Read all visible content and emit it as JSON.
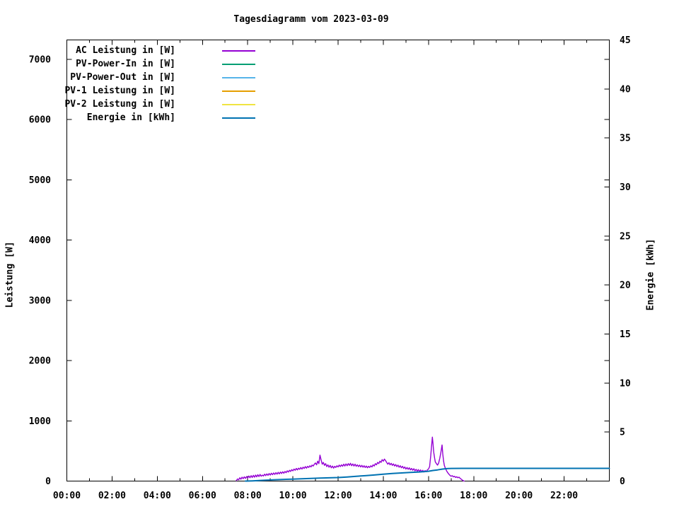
{
  "chart_data": {
    "type": "line",
    "title": "Tagesdiagramm vom 2023-03-09",
    "grid": false,
    "legend_position": "top-left-inside",
    "x_axis": {
      "unit": "time-of-day",
      "range_hours": [
        0,
        24
      ],
      "major_tick_every_hours": 2,
      "minor_tick_every_hours": 1,
      "tick_labels": [
        "00:00",
        "02:00",
        "04:00",
        "06:00",
        "08:00",
        "10:00",
        "12:00",
        "14:00",
        "16:00",
        "18:00",
        "20:00",
        "22:00"
      ]
    },
    "y_left_axis": {
      "label": "Leistung [W]",
      "ticks": [
        0,
        1000,
        2000,
        3000,
        4000,
        5000,
        6000,
        7000
      ],
      "range": [
        0,
        7320
      ]
    },
    "y_right_axis": {
      "label": "Energie [kWh]",
      "ticks": [
        0,
        5,
        10,
        15,
        20,
        25,
        30,
        35,
        40,
        45
      ],
      "range": [
        0,
        45
      ]
    },
    "series": [
      {
        "name": "AC Leistung in [W]",
        "color": "#9400D3",
        "axis": "left",
        "points": [
          [
            7.5,
            8
          ],
          [
            7.55,
            35
          ],
          [
            7.6,
            20
          ],
          [
            7.65,
            55
          ],
          [
            7.7,
            30
          ],
          [
            7.75,
            65
          ],
          [
            7.8,
            40
          ],
          [
            7.85,
            70
          ],
          [
            7.9,
            45
          ],
          [
            7.95,
            75
          ],
          [
            8.0,
            50
          ],
          [
            8.05,
            85
          ],
          [
            8.1,
            55
          ],
          [
            8.15,
            90
          ],
          [
            8.2,
            60
          ],
          [
            8.25,
            95
          ],
          [
            8.3,
            65
          ],
          [
            8.35,
            100
          ],
          [
            8.4,
            70
          ],
          [
            8.45,
            105
          ],
          [
            8.5,
            75
          ],
          [
            8.55,
            110
          ],
          [
            8.6,
            80
          ],
          [
            8.65,
            100
          ],
          [
            8.7,
            85
          ],
          [
            8.75,
            115
          ],
          [
            8.8,
            90
          ],
          [
            8.85,
            120
          ],
          [
            8.9,
            95
          ],
          [
            8.95,
            125
          ],
          [
            9.0,
            100
          ],
          [
            9.05,
            130
          ],
          [
            9.1,
            105
          ],
          [
            9.15,
            135
          ],
          [
            9.2,
            110
          ],
          [
            9.25,
            140
          ],
          [
            9.3,
            115
          ],
          [
            9.35,
            145
          ],
          [
            9.4,
            120
          ],
          [
            9.45,
            150
          ],
          [
            9.5,
            125
          ],
          [
            9.55,
            155
          ],
          [
            9.6,
            130
          ],
          [
            9.65,
            160
          ],
          [
            9.7,
            140
          ],
          [
            9.75,
            170
          ],
          [
            9.8,
            150
          ],
          [
            9.85,
            180
          ],
          [
            9.9,
            160
          ],
          [
            9.95,
            190
          ],
          [
            10.0,
            170
          ],
          [
            10.05,
            200
          ],
          [
            10.1,
            180
          ],
          [
            10.15,
            210
          ],
          [
            10.2,
            185
          ],
          [
            10.25,
            215
          ],
          [
            10.3,
            195
          ],
          [
            10.35,
            225
          ],
          [
            10.4,
            200
          ],
          [
            10.45,
            230
          ],
          [
            10.5,
            210
          ],
          [
            10.55,
            240
          ],
          [
            10.6,
            215
          ],
          [
            10.65,
            245
          ],
          [
            10.7,
            225
          ],
          [
            10.75,
            255
          ],
          [
            10.8,
            235
          ],
          [
            10.85,
            265
          ],
          [
            10.9,
            250
          ],
          [
            10.95,
            280
          ],
          [
            11.0,
            300
          ],
          [
            11.05,
            270
          ],
          [
            11.1,
            330
          ],
          [
            11.15,
            290
          ],
          [
            11.2,
            430
          ],
          [
            11.25,
            350
          ],
          [
            11.3,
            280
          ],
          [
            11.35,
            310
          ],
          [
            11.4,
            260
          ],
          [
            11.45,
            290
          ],
          [
            11.5,
            240
          ],
          [
            11.55,
            270
          ],
          [
            11.6,
            230
          ],
          [
            11.65,
            260
          ],
          [
            11.7,
            220
          ],
          [
            11.75,
            250
          ],
          [
            11.8,
            215
          ],
          [
            11.85,
            245
          ],
          [
            11.9,
            225
          ],
          [
            11.95,
            255
          ],
          [
            12.0,
            235
          ],
          [
            12.05,
            265
          ],
          [
            12.1,
            240
          ],
          [
            12.15,
            270
          ],
          [
            12.2,
            245
          ],
          [
            12.25,
            280
          ],
          [
            12.3,
            250
          ],
          [
            12.35,
            285
          ],
          [
            12.4,
            255
          ],
          [
            12.45,
            290
          ],
          [
            12.5,
            260
          ],
          [
            12.55,
            295
          ],
          [
            12.6,
            255
          ],
          [
            12.65,
            285
          ],
          [
            12.7,
            250
          ],
          [
            12.75,
            280
          ],
          [
            12.8,
            245
          ],
          [
            12.85,
            270
          ],
          [
            12.9,
            240
          ],
          [
            12.95,
            265
          ],
          [
            13.0,
            235
          ],
          [
            13.05,
            260
          ],
          [
            13.1,
            230
          ],
          [
            13.15,
            255
          ],
          [
            13.2,
            225
          ],
          [
            13.25,
            250
          ],
          [
            13.3,
            220
          ],
          [
            13.35,
            245
          ],
          [
            13.4,
            225
          ],
          [
            13.45,
            255
          ],
          [
            13.5,
            235
          ],
          [
            13.55,
            270
          ],
          [
            13.6,
            250
          ],
          [
            13.65,
            290
          ],
          [
            13.7,
            270
          ],
          [
            13.75,
            310
          ],
          [
            13.8,
            290
          ],
          [
            13.85,
            330
          ],
          [
            13.9,
            310
          ],
          [
            13.95,
            355
          ],
          [
            14.0,
            330
          ],
          [
            14.05,
            365
          ],
          [
            14.1,
            340
          ],
          [
            14.15,
            310
          ],
          [
            14.2,
            280
          ],
          [
            14.25,
            305
          ],
          [
            14.3,
            270
          ],
          [
            14.35,
            295
          ],
          [
            14.4,
            260
          ],
          [
            14.45,
            285
          ],
          [
            14.5,
            250
          ],
          [
            14.55,
            275
          ],
          [
            14.6,
            240
          ],
          [
            14.65,
            265
          ],
          [
            14.7,
            230
          ],
          [
            14.75,
            255
          ],
          [
            14.8,
            220
          ],
          [
            14.85,
            245
          ],
          [
            14.9,
            210
          ],
          [
            14.95,
            235
          ],
          [
            15.0,
            200
          ],
          [
            15.05,
            225
          ],
          [
            15.1,
            195
          ],
          [
            15.15,
            220
          ],
          [
            15.2,
            185
          ],
          [
            15.25,
            210
          ],
          [
            15.3,
            180
          ],
          [
            15.35,
            205
          ],
          [
            15.4,
            170
          ],
          [
            15.45,
            195
          ],
          [
            15.5,
            165
          ],
          [
            15.55,
            190
          ],
          [
            15.6,
            160
          ],
          [
            15.65,
            185
          ],
          [
            15.7,
            155
          ],
          [
            15.75,
            180
          ],
          [
            15.8,
            150
          ],
          [
            15.85,
            175
          ],
          [
            15.9,
            155
          ],
          [
            15.95,
            185
          ],
          [
            16.0,
            200
          ],
          [
            16.05,
            240
          ],
          [
            16.1,
            420
          ],
          [
            16.13,
            560
          ],
          [
            16.17,
            730
          ],
          [
            16.2,
            620
          ],
          [
            16.23,
            480
          ],
          [
            16.27,
            380
          ],
          [
            16.3,
            320
          ],
          [
            16.35,
            290
          ],
          [
            16.4,
            265
          ],
          [
            16.45,
            300
          ],
          [
            16.5,
            380
          ],
          [
            16.55,
            480
          ],
          [
            16.6,
            600
          ],
          [
            16.63,
            450
          ],
          [
            16.67,
            330
          ],
          [
            16.7,
            260
          ],
          [
            16.75,
            210
          ],
          [
            16.8,
            170
          ],
          [
            16.85,
            140
          ],
          [
            16.9,
            115
          ],
          [
            16.95,
            95
          ],
          [
            17.0,
            80
          ],
          [
            17.05,
            90
          ],
          [
            17.1,
            70
          ],
          [
            17.15,
            80
          ],
          [
            17.2,
            60
          ],
          [
            17.25,
            72
          ],
          [
            17.3,
            55
          ],
          [
            17.35,
            65
          ],
          [
            17.4,
            45
          ],
          [
            17.45,
            30
          ],
          [
            17.5,
            15
          ],
          [
            17.55,
            5
          ],
          [
            17.58,
            0
          ]
        ]
      },
      {
        "name": "PV-Power-In in [W]",
        "color": "#009E73",
        "axis": "left",
        "points": []
      },
      {
        "name": "PV-Power-Out in [W]",
        "color": "#56B4E9",
        "axis": "left",
        "points": []
      },
      {
        "name": "PV-1 Leistung in [W]",
        "color": "#E69F00",
        "axis": "left",
        "points": []
      },
      {
        "name": "PV-2 Leistung in [W]",
        "color": "#F0E442",
        "axis": "left",
        "points": []
      },
      {
        "name": "Energie in [kWh]",
        "color": "#0072B2",
        "axis": "right",
        "points": [
          [
            7.9,
            0
          ],
          [
            8.2,
            0.02
          ],
          [
            8.5,
            0.05
          ],
          [
            8.8,
            0.09
          ],
          [
            9.1,
            0.12
          ],
          [
            9.4,
            0.15
          ],
          [
            9.7,
            0.18
          ],
          [
            10.0,
            0.2
          ],
          [
            10.4,
            0.24
          ],
          [
            10.8,
            0.27
          ],
          [
            11.2,
            0.31
          ],
          [
            11.6,
            0.33
          ],
          [
            12.0,
            0.36
          ],
          [
            12.4,
            0.42
          ],
          [
            12.8,
            0.49
          ],
          [
            13.2,
            0.55
          ],
          [
            13.6,
            0.62
          ],
          [
            14.0,
            0.7
          ],
          [
            14.4,
            0.77
          ],
          [
            14.8,
            0.83
          ],
          [
            15.2,
            0.88
          ],
          [
            15.6,
            0.93
          ],
          [
            16.0,
            1.0
          ],
          [
            16.2,
            1.08
          ],
          [
            16.4,
            1.14
          ],
          [
            16.6,
            1.22
          ],
          [
            16.8,
            1.27
          ],
          [
            17.0,
            1.29
          ],
          [
            17.5,
            1.3
          ],
          [
            24.0,
            1.3
          ]
        ]
      }
    ]
  }
}
